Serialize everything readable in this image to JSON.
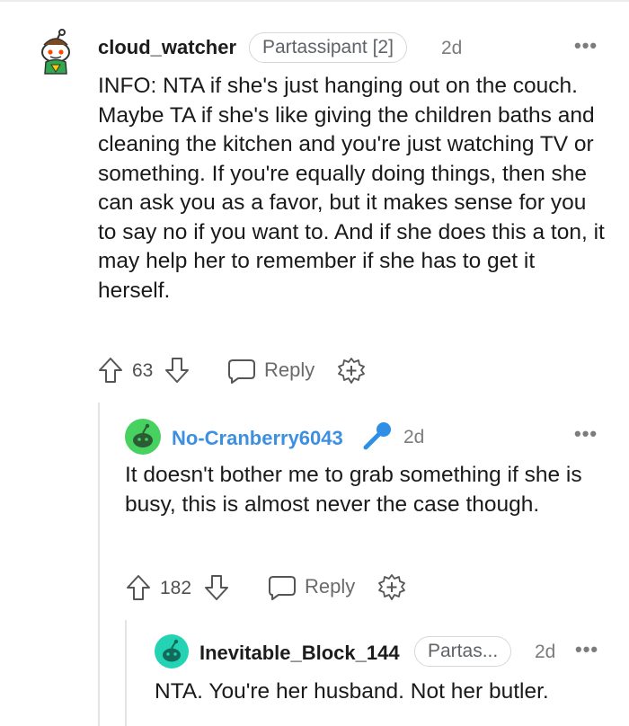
{
  "comments": [
    {
      "username": "cloud_watcher",
      "flair": "Partassipant [2]",
      "time": "2d",
      "body": "INFO: NTA if she's just hanging out on the couch. Maybe TA if she's like giving the children baths and cleaning the kitchen and you're just watching TV or something. If you're equally doing things, then she can ask you as a favor, but it makes sense for you to say no if you want to. And if she does this a ton, it may help her to remember if she has to get it herself.",
      "votes": "63",
      "reply_label": "Reply"
    },
    {
      "username": "No-Cranberry6043",
      "time": "2d",
      "body": "It doesn't bother me to grab something if she is busy, this is almost never the case though.",
      "votes": "182",
      "reply_label": "Reply"
    },
    {
      "username": "Inevitable_Block_144",
      "flair": "Partas...",
      "time": "2d",
      "body": "NTA. You're her husband. Not her butler."
    }
  ],
  "more_glyph": "•••",
  "colors": {
    "username_op": "#3d8fe0",
    "avatar2": "#46d160",
    "avatar3": "#24d3b4",
    "thread_line": "#e4e4e4"
  },
  "icons": [
    "avatar-icon",
    "upvote-icon",
    "downvote-icon",
    "comment-icon",
    "award-icon",
    "microphone-icon",
    "more-options-icon"
  ]
}
